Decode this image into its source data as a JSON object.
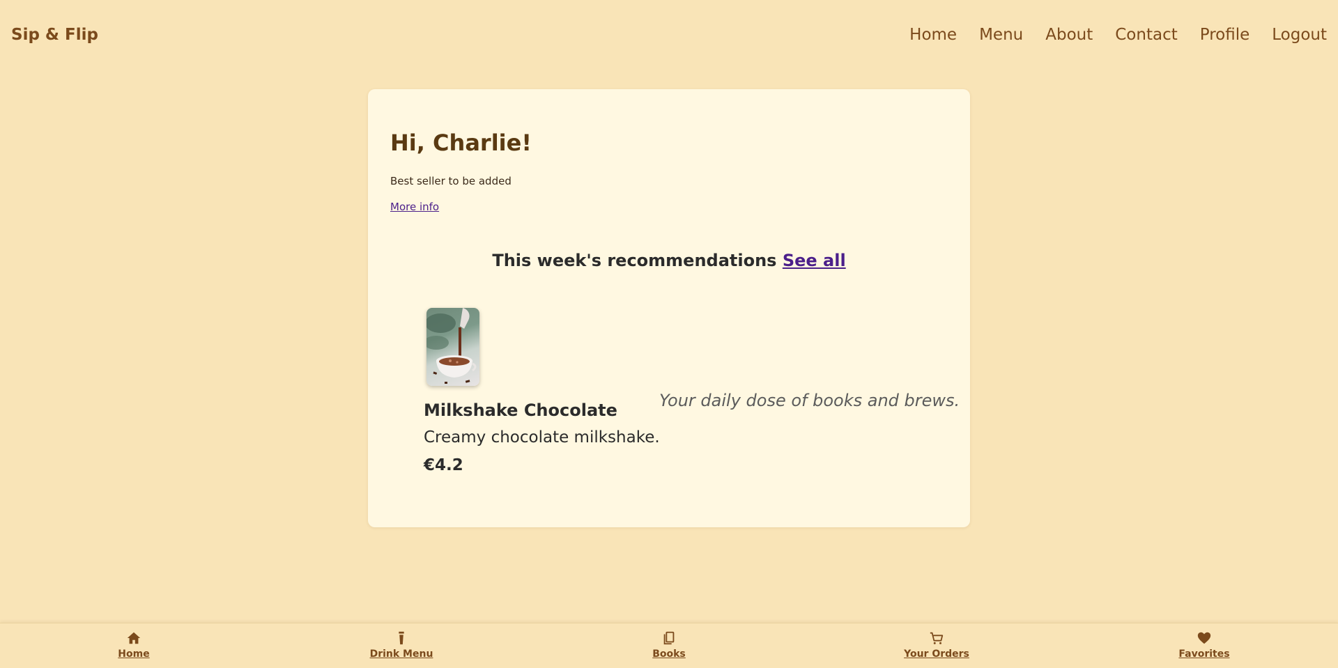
{
  "header": {
    "brand": "Sip & Flip",
    "nav": [
      "Home",
      "Menu",
      "About",
      "Contact",
      "Profile",
      "Logout"
    ]
  },
  "card": {
    "greeting": "Hi, Charlie!",
    "bestseller": "Best seller to be added",
    "more_info": "More info",
    "recs_title": "This week's recommendations",
    "see_all": "See all",
    "product": {
      "image_alt": "hot chocolate being poured into a cup",
      "name": "Milkshake Chocolate",
      "description": "Creamy chocolate milkshake.",
      "price": "€4.2"
    },
    "tagline": "Your daily dose of books and brews."
  },
  "bottom_nav": [
    {
      "label": "Home",
      "icon": "home-icon"
    },
    {
      "label": "Drink Menu",
      "icon": "cup-icon"
    },
    {
      "label": "Books",
      "icon": "book-icon"
    },
    {
      "label": "Your Orders",
      "icon": "cart-icon"
    },
    {
      "label": "Favorites",
      "icon": "heart-icon"
    }
  ],
  "colors": {
    "background": "#f9e4b7",
    "card": "#fff8e1",
    "brand": "#7b4a1c",
    "link": "#4b1f8a"
  }
}
